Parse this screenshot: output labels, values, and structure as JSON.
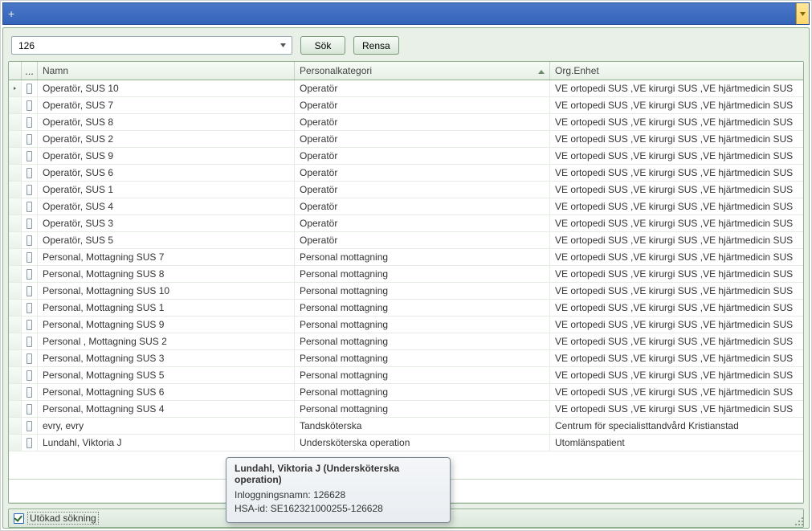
{
  "search": {
    "value": "126",
    "sok_label": "Sök",
    "rensa_label": "Rensa"
  },
  "columns": {
    "dots": "...",
    "name": "Namn",
    "category": "Personalkategori",
    "org": "Org.Enhet"
  },
  "common_org": "VE ortopedi SUS ,VE kirurgi SUS ,VE hjärtmedicin SUS",
  "rows": [
    {
      "name": "Operatör, SUS 10",
      "cat": "Operatör",
      "org_ref": "common",
      "arrow": true
    },
    {
      "name": "Operatör, SUS 7",
      "cat": "Operatör",
      "org_ref": "common"
    },
    {
      "name": "Operatör, SUS 8",
      "cat": "Operatör",
      "org_ref": "common"
    },
    {
      "name": "Operatör, SUS 2",
      "cat": "Operatör",
      "org_ref": "common"
    },
    {
      "name": "Operatör, SUS 9",
      "cat": "Operatör",
      "org_ref": "common"
    },
    {
      "name": "Operatör, SUS 6",
      "cat": "Operatör",
      "org_ref": "common"
    },
    {
      "name": "Operatör, SUS 1",
      "cat": "Operatör",
      "org_ref": "common"
    },
    {
      "name": "Operatör, SUS 4",
      "cat": "Operatör",
      "org_ref": "common"
    },
    {
      "name": "Operatör, SUS 3",
      "cat": "Operatör",
      "org_ref": "common"
    },
    {
      "name": "Operatör, SUS 5",
      "cat": "Operatör",
      "org_ref": "common"
    },
    {
      "name": "Personal, Mottagning SUS 7",
      "cat": "Personal mottagning",
      "org_ref": "common"
    },
    {
      "name": "Personal, Mottagning SUS 8",
      "cat": "Personal mottagning",
      "org_ref": "common"
    },
    {
      "name": "Personal, Mottagning SUS 10",
      "cat": "Personal mottagning",
      "org_ref": "common"
    },
    {
      "name": "Personal, Mottagning SUS 1",
      "cat": "Personal mottagning",
      "org_ref": "common"
    },
    {
      "name": "Personal, Mottagning SUS 9",
      "cat": "Personal mottagning",
      "org_ref": "common"
    },
    {
      "name": "Personal , Mottagning SUS 2",
      "cat": "Personal mottagning",
      "org_ref": "common"
    },
    {
      "name": "Personal, Mottagning SUS 3",
      "cat": "Personal mottagning",
      "org_ref": "common"
    },
    {
      "name": "Personal, Mottagning SUS 5",
      "cat": "Personal mottagning",
      "org_ref": "common"
    },
    {
      "name": "Personal, Mottagning SUS 6",
      "cat": "Personal mottagning",
      "org_ref": "common"
    },
    {
      "name": "Personal, Mottagning SUS 4",
      "cat": "Personal mottagning",
      "org_ref": "common"
    },
    {
      "name": "evry, evry",
      "cat": "Tandsköterska",
      "org": "Centrum för specialisttandvård Kristianstad"
    },
    {
      "name": "Lundahl, Viktoria J",
      "cat": "Undersköterska operation",
      "org": "Utomlänspatient"
    }
  ],
  "footer": {
    "extended_search_label": "Utökad sökning",
    "extended_search_checked": true
  },
  "tooltip": {
    "title": "Lundahl, Viktoria J (Undersköterska operation)",
    "login_label": "Inloggningsnamn:",
    "login_value": "126628",
    "hsa_label": "HSA-id:",
    "hsa_value": "SE162321000255-126628"
  }
}
